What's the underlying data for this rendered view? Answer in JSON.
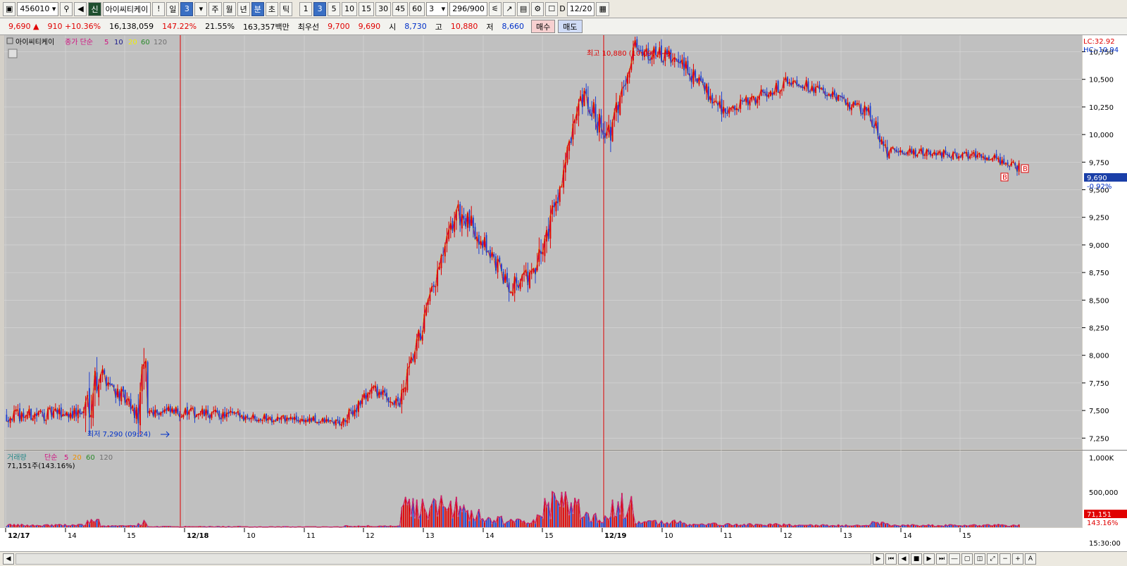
{
  "toolbar": {
    "code": "456010",
    "stock_name": "아이씨티케이",
    "credit_badge": "신",
    "notice": "!",
    "period_day": "일",
    "period_count": "3",
    "period_week": "주",
    "period_month": "월",
    "period_year": "년",
    "period_minute": "분",
    "period_second": "초",
    "period_tick": "틱",
    "minute_options": [
      "1",
      "3",
      "5",
      "10",
      "15",
      "30",
      "45",
      "60"
    ],
    "active_minute": "3",
    "interval_value": "3",
    "count_display": "296/900",
    "d_label": "D",
    "date_value": "12/20"
  },
  "quote": {
    "price": "9,690",
    "change": "910",
    "change_rate": "+10.36%",
    "volume": "16,138,059",
    "volume_ratio": "147.22%",
    "turnover": "21.55%",
    "amount": "163,357백만",
    "best_ask_label": "최우선",
    "best_ask": "9,700",
    "best_bid": "9,690",
    "open_label": "시",
    "open": "8,730",
    "high_label": "고",
    "high": "10,880",
    "low_label": "저",
    "low": "8,660",
    "buy_label": "매수",
    "sell_label": "매도"
  },
  "colors": {
    "up": "#e00000",
    "down": "#1f3fd0",
    "ma5": "#d01080",
    "ma10": "#1a1a8a",
    "ma20": "#f0f000",
    "ma60": "#2a8a2a",
    "ma120": "#707070",
    "bg": "#c0c0c0"
  },
  "chart_data": {
    "type": "candlestick",
    "price_legend": {
      "name": "아이씨티케이",
      "kind": "종가 단순",
      "periods": [
        "5",
        "10",
        "20",
        "60",
        "120"
      ]
    },
    "volume_legend": {
      "name": "거래량",
      "kind": "단순",
      "periods": [
        "5",
        "20",
        "60",
        "120"
      ],
      "value": "71,151주(143.16%)"
    },
    "price_axis": {
      "ticks": [
        "10,750",
        "10,500",
        "10,250",
        "10,000",
        "9,750",
        "9,500",
        "9,250",
        "9,000",
        "8,750",
        "8,500",
        "8,250",
        "8,000",
        "7,750",
        "7,500",
        "7,250"
      ],
      "ylim": [
        7150,
        10900
      ],
      "lc": "LC:32.92",
      "hc": "HC:-10.94",
      "current_price": "9,690",
      "current_pct": "-0.92%"
    },
    "volume_axis": {
      "ticks": [
        "1,000K",
        "500,000"
      ],
      "max": 1050000,
      "current": "71,151",
      "current_pct": "143.16%"
    },
    "x_labels": [
      "12/17",
      "14",
      "15",
      "12/18",
      "10",
      "11",
      "12",
      "13",
      "14",
      "15",
      "12/19",
      "10",
      "11",
      "12",
      "13",
      "14",
      "15"
    ],
    "x_label_time": "15:30:00",
    "annotations": {
      "high": "최고 10,880 (10:09)",
      "low": "최저 7,290 (09:24)",
      "marker": "B"
    },
    "segments": [
      {
        "count": 42,
        "start": 7450,
        "end": 7480,
        "amp": 120,
        "vol": 25000
      },
      {
        "count": 8,
        "start": 7500,
        "end": 7870,
        "amp": 450,
        "vol": 70000
      },
      {
        "count": 20,
        "start": 7870,
        "end": 7460,
        "amp": 150,
        "vol": 15000
      },
      {
        "count": 5,
        "start": 7460,
        "end": 7850,
        "amp": 450,
        "vol": 60000
      },
      {
        "count": 50,
        "start": 7500,
        "end": 7450,
        "amp": 100,
        "vol": 8000
      },
      {
        "count": 55,
        "start": 7450,
        "end": 7390,
        "amp": 80,
        "vol": 6000
      },
      {
        "count": 15,
        "start": 7390,
        "end": 7700,
        "amp": 120,
        "vol": 15000
      },
      {
        "count": 15,
        "start": 7700,
        "end": 7550,
        "amp": 100,
        "vol": 12000
      },
      {
        "count": 30,
        "start": 7550,
        "end": 9300,
        "amp": 200,
        "vol": 250000
      },
      {
        "count": 12,
        "start": 9300,
        "end": 9100,
        "amp": 200,
        "vol": 180000
      },
      {
        "count": 15,
        "start": 9100,
        "end": 8650,
        "amp": 150,
        "vol": 90000
      },
      {
        "count": 15,
        "start": 8650,
        "end": 8730,
        "amp": 200,
        "vol": 70000
      },
      {
        "count": 25,
        "start": 8730,
        "end": 10300,
        "amp": 250,
        "vol": 280000
      },
      {
        "count": 15,
        "start": 10300,
        "end": 10000,
        "amp": 250,
        "vol": 120000
      },
      {
        "count": 12,
        "start": 10000,
        "end": 10800,
        "amp": 200,
        "vol": 280000
      },
      {
        "count": 25,
        "start": 10800,
        "end": 10650,
        "amp": 150,
        "vol": 60000
      },
      {
        "count": 25,
        "start": 10650,
        "end": 10200,
        "amp": 150,
        "vol": 35000
      },
      {
        "count": 35,
        "start": 10200,
        "end": 10500,
        "amp": 120,
        "vol": 30000
      },
      {
        "count": 40,
        "start": 10500,
        "end": 10200,
        "amp": 100,
        "vol": 22000
      },
      {
        "count": 10,
        "start": 10200,
        "end": 9850,
        "amp": 150,
        "vol": 45000
      },
      {
        "count": 55,
        "start": 9850,
        "end": 9800,
        "amp": 80,
        "vol": 22000
      },
      {
        "count": 15,
        "start": 9800,
        "end": 9700,
        "amp": 100,
        "vol": 25000
      }
    ]
  }
}
